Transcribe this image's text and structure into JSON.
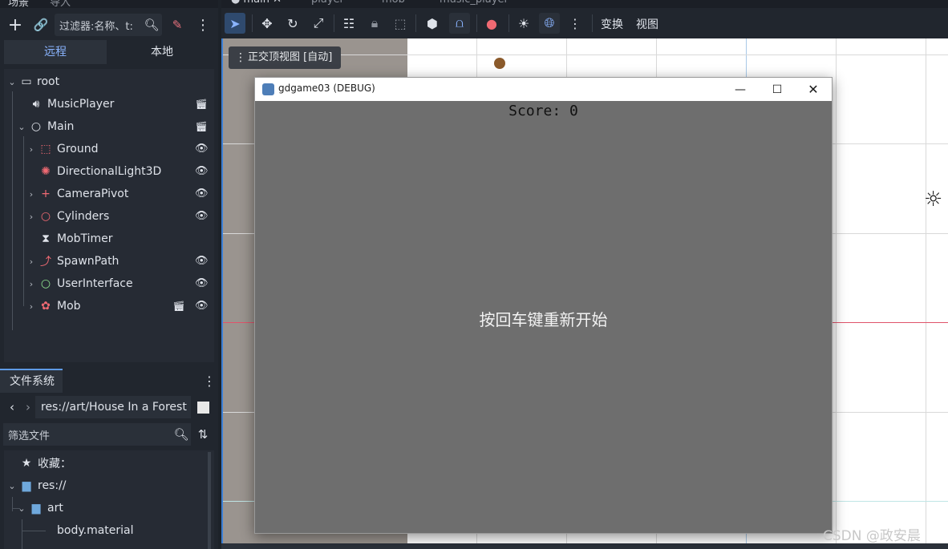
{
  "scene_dock": {
    "filter_placeholder": "过滤器:名称、t:",
    "tab_remote": "远程",
    "tab_local": "本地",
    "nodes": [
      {
        "label": "root",
        "icon": "node3d-root-icon"
      },
      {
        "label": "MusicPlayer",
        "icon": "audio-stream-player-icon"
      },
      {
        "label": "Main",
        "icon": "node-icon"
      },
      {
        "label": "Ground",
        "icon": "static-body-icon"
      },
      {
        "label": "DirectionalLight3D",
        "icon": "directional-light-icon"
      },
      {
        "label": "CameraPivot",
        "icon": "marker3d-icon"
      },
      {
        "label": "Cylinders",
        "icon": "node3d-icon"
      },
      {
        "label": "MobTimer",
        "icon": "timer-icon"
      },
      {
        "label": "SpawnPath",
        "icon": "path3d-icon"
      },
      {
        "label": "UserInterface",
        "icon": "control-icon"
      },
      {
        "label": "Mob",
        "icon": "character-body-icon"
      }
    ]
  },
  "filesystem": {
    "tab_label": "文件系统",
    "path": "res://art/House In a Forest",
    "filter_placeholder": "筛选文件",
    "items": [
      {
        "label": "收藏："
      },
      {
        "label": "res://"
      },
      {
        "label": "art"
      },
      {
        "label": "body.material"
      }
    ]
  },
  "viewport": {
    "toolbar_transform": "变换",
    "toolbar_view": "视图",
    "view_label": "正交顶视图 [自动]"
  },
  "game_window": {
    "title": "gdgame03 (DEBUG)",
    "score": "Score: 0",
    "restart_text": "按回车键重新开始"
  },
  "watermark": "CSDN @政安晨",
  "colors": {
    "accent": "#5e9be6",
    "red_axis": "#e0536a",
    "game_bg": "#6e6e6e"
  }
}
